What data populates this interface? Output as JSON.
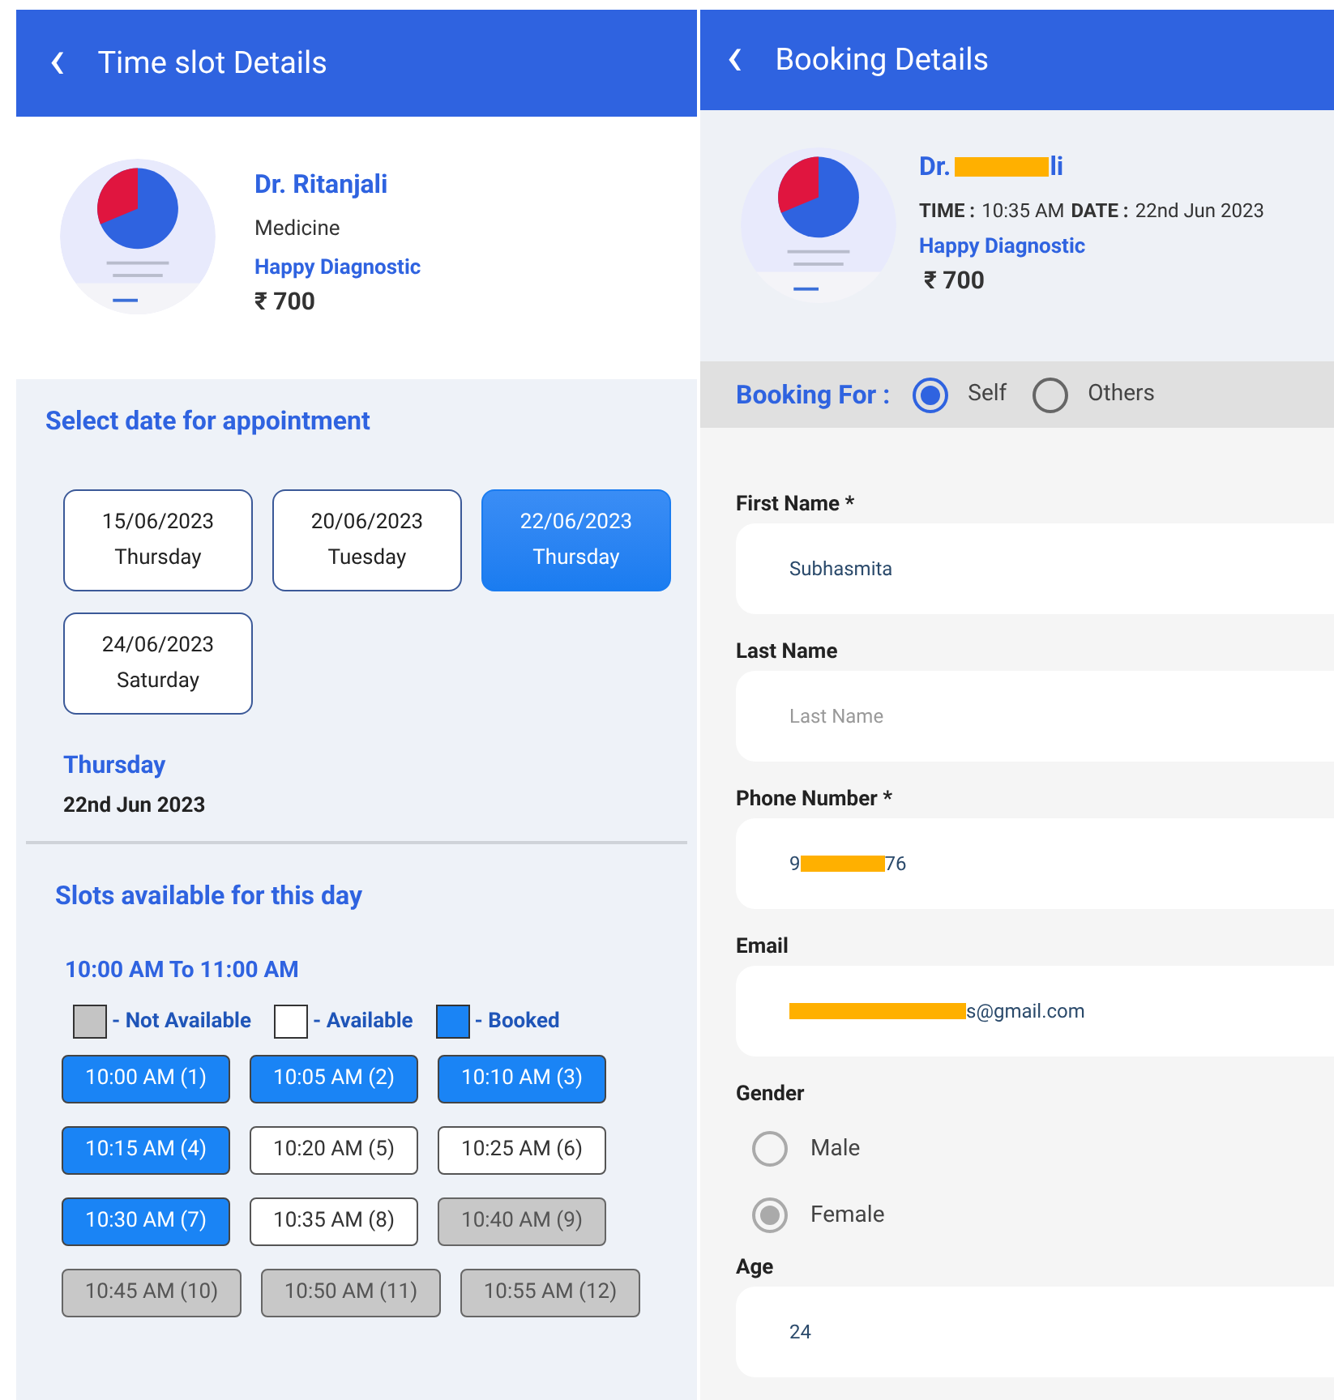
{
  "left": {
    "header": {
      "back": "‹",
      "title": "Time slot Details"
    },
    "doctor": {
      "name": "Dr. Ritanjali",
      "speciality": "Medicine",
      "clinic": "Happy Diagnostic",
      "fee": "₹ 700"
    },
    "date_heading": "Select date for appointment",
    "dates": [
      {
        "date": "15/06/2023",
        "day": "Thursday",
        "selected": false
      },
      {
        "date": "20/06/2023",
        "day": "Tuesday",
        "selected": false
      },
      {
        "date": "22/06/2023",
        "day": "Thursday",
        "selected": true
      },
      {
        "date": "24/06/2023",
        "day": "Saturday",
        "selected": false
      }
    ],
    "chosen_day": "Thursday",
    "chosen_date": "22nd Jun 2023",
    "slots_heading": "Slots available for this day",
    "range": "10:00 AM To 11:00 AM",
    "legend": [
      {
        "kind": "unavailable",
        "label": "- Not Available"
      },
      {
        "kind": "available",
        "label": "- Available"
      },
      {
        "kind": "booked",
        "label": "- Booked"
      }
    ],
    "slot_rows": [
      [
        {
          "label": "10:00 AM (1)",
          "kind": "booked"
        },
        {
          "label": "10:05 AM (2)",
          "kind": "booked"
        },
        {
          "label": "10:10 AM (3)",
          "kind": "booked"
        }
      ],
      [
        {
          "label": "10:15 AM (4)",
          "kind": "booked"
        },
        {
          "label": "10:20 AM (5)",
          "kind": "available"
        },
        {
          "label": "10:25 AM (6)",
          "kind": "available"
        }
      ],
      [
        {
          "label": "10:30 AM (7)",
          "kind": "booked"
        },
        {
          "label": "10:35 AM (8)",
          "kind": "available"
        },
        {
          "label": "10:40 AM (9)",
          "kind": "unavailable"
        }
      ],
      [
        {
          "label": "10:45 AM (10)",
          "kind": "unavailable"
        },
        {
          "label": "10:50 AM (11)",
          "kind": "unavailable"
        },
        {
          "label": "10:55 AM (12)",
          "kind": "unavailable"
        }
      ]
    ]
  },
  "right": {
    "header": {
      "back": "‹",
      "title": "Booking Details"
    },
    "doctor": {
      "name": {
        "before": "Dr.",
        "after": "li"
      },
      "time_label": "TIME :",
      "time": "10:35 AM",
      "date_label": "DATE :",
      "date": "22nd Jun 2023",
      "clinic": "Happy Diagnostic",
      "fee": "₹ 700"
    },
    "booking_for": {
      "label": "Booking For :",
      "options": [
        {
          "label": "Self",
          "selected": true
        },
        {
          "label": "Others",
          "selected": false
        }
      ]
    },
    "fields": [
      {
        "kind": "text",
        "label": "First Name *",
        "value": "Subhasmita"
      },
      {
        "kind": "text",
        "label": "Last Name",
        "placeholder": "Last Name"
      },
      {
        "kind": "redacted",
        "label": "Phone Number *",
        "before": "9",
        "after": "76"
      },
      {
        "kind": "redacted",
        "label": "Email",
        "after": "s@gmail.com"
      },
      {
        "kind": "radio",
        "label": "Gender",
        "options": [
          {
            "label": "Male",
            "selected": false
          },
          {
            "label": "Female",
            "selected": true
          }
        ]
      },
      {
        "kind": "text",
        "label": "Age",
        "value": "24"
      }
    ]
  }
}
